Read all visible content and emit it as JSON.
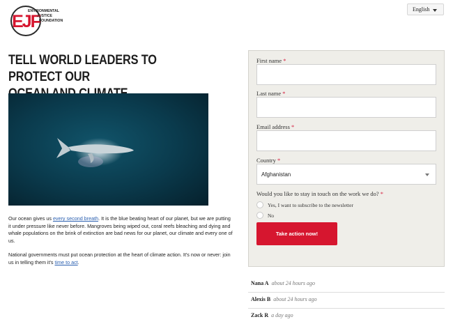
{
  "header": {
    "logo": {
      "letters": "EJF",
      "line1": "ENVIRONMENTAL",
      "line2": "JUSTICE",
      "line3": "FOUNDATION"
    },
    "language": {
      "selected": "English"
    }
  },
  "main": {
    "headline_line1": "TELL WORLD LEADERS TO PROTECT OUR",
    "headline_line2": "OCEAN AND CLIMATE",
    "p1": {
      "before": "Our ocean gives us ",
      "link": "every second breath",
      "after": ". It is the blue beating heart of our planet, but we are putting it under pressure like never before. Mangroves being wiped out, coral reefs bleaching and dying and whale populations on the brink of extinction are bad news for our planet, our climate and every one of us."
    },
    "p2": {
      "before": "National governments must put ocean protection at the heart of climate action. It's now or never: join us in telling them it's ",
      "link": "time to act",
      "after": "."
    }
  },
  "form": {
    "first_name": {
      "label": "First name",
      "value": ""
    },
    "last_name": {
      "label": "Last name",
      "value": ""
    },
    "email": {
      "label": "Email address",
      "value": ""
    },
    "country": {
      "label": "Country",
      "value": "Afghanistan"
    },
    "required_marker": "*",
    "newsletter_question": "Would you like to stay in touch on the work we do?",
    "option_yes": "Yes, I want to subscribe to the newsletter",
    "option_no": "No",
    "submit_label": "Take action now!"
  },
  "signatures": [
    {
      "name": "Nana A",
      "time": "about 24 hours ago"
    },
    {
      "name": "Alexis B",
      "time": "about 24 hours ago"
    },
    {
      "name": "Zack R",
      "time": "a day ago"
    }
  ],
  "colors": {
    "accent": "#d6162f",
    "panel_bg": "#efeee9",
    "link": "#2a5fb0",
    "ocean": "#0b3a4a"
  },
  "icons": {
    "language_caret": "chevron-down-icon",
    "country_caret": "chevron-down-icon"
  }
}
